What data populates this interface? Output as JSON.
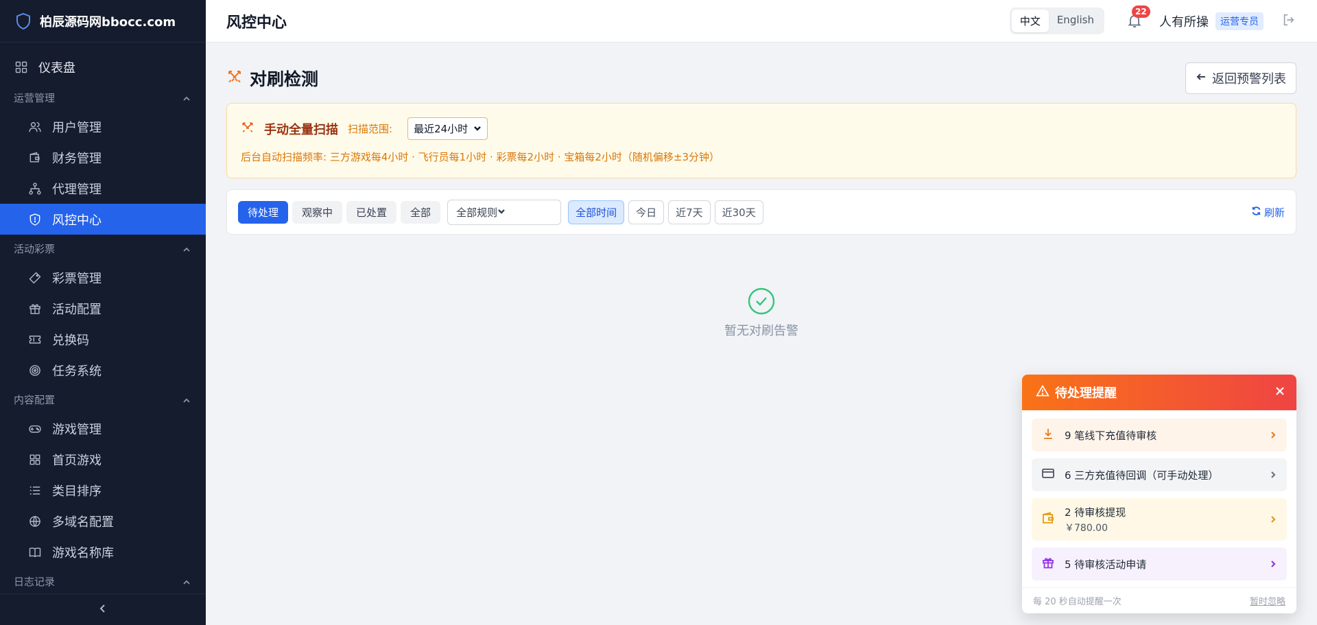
{
  "brand": {
    "name": "柏辰源码网bbocc.com",
    "icon": "shield-icon"
  },
  "sidebar": {
    "dashboard": {
      "label": "仪表盘",
      "icon": "grid-icon"
    },
    "groups": [
      {
        "title": "运营管理",
        "items": [
          {
            "label": "用户管理",
            "icon": "users-icon"
          },
          {
            "label": "财务管理",
            "icon": "wallet-icon"
          },
          {
            "label": "代理管理",
            "icon": "hierarchy-icon"
          },
          {
            "label": "风控中心",
            "icon": "shield-icon",
            "active": true
          }
        ]
      },
      {
        "title": "活动彩票",
        "items": [
          {
            "label": "彩票管理",
            "icon": "ticket-icon"
          },
          {
            "label": "活动配置",
            "icon": "gift-icon"
          },
          {
            "label": "兑换码",
            "icon": "coupon-icon"
          },
          {
            "label": "任务系统",
            "icon": "target-icon"
          }
        ]
      },
      {
        "title": "内容配置",
        "items": [
          {
            "label": "游戏管理",
            "icon": "gamepad-icon"
          },
          {
            "label": "首页游戏",
            "icon": "grid-icon"
          },
          {
            "label": "类目排序",
            "icon": "list-icon"
          },
          {
            "label": "多域名配置",
            "icon": "globe-icon"
          },
          {
            "label": "游戏名称库",
            "icon": "book-icon"
          }
        ]
      },
      {
        "title": "日志记录",
        "items": []
      }
    ]
  },
  "header": {
    "title": "风控中心",
    "lang": {
      "zh": "中文",
      "en": "English",
      "active": "zh"
    },
    "notifications": "22",
    "user": "人有所操",
    "role": "运营专员"
  },
  "page": {
    "title": "对刷检测",
    "back_label": "返回预警列表"
  },
  "scan": {
    "title": "手动全量扫描",
    "range_label": "扫描范围:",
    "range_value": "最近24小时",
    "note": "后台自动扫描频率: 三方游戏每4小时 · 飞行员每1小时 · 彩票每2小时 · 宝箱每2小时（随机偏移±3分钟）"
  },
  "filters": {
    "status_tabs": [
      "待处理",
      "观察中",
      "已处置",
      "全部"
    ],
    "active_status": "待处理",
    "rule_select": "全部规则",
    "time_tabs": [
      "全部时间",
      "今日",
      "近7天",
      "近30天"
    ],
    "active_time": "全部时间",
    "refresh_label": "刷新"
  },
  "empty": {
    "text": "暂无对刷告警"
  },
  "reminder": {
    "title": "待处理提醒",
    "items": [
      {
        "text": "9 笔线下充值待审核",
        "icon": "download-icon",
        "color": "#ea7b1c",
        "bg": "#fff4ea"
      },
      {
        "text": "6 三方充值待回调（可手动处理）",
        "icon": "card-icon",
        "color": "#4b5563",
        "bg": "#f3f4f6"
      },
      {
        "text": "2 待审核提现",
        "sub": "￥780.00",
        "icon": "wallet-icon",
        "color": "#e59a12",
        "bg": "#fff8e6"
      },
      {
        "text": "5 待审核活动申请",
        "icon": "gift-icon",
        "color": "#9333ea",
        "bg": "#f7f0fd"
      }
    ],
    "footer": "每 20 秒自动提醒一次",
    "ignore": "暂时忽略"
  }
}
